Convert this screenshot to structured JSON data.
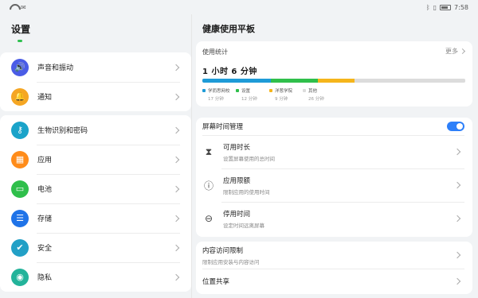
{
  "status": {
    "time": "7:58",
    "left_glyph": "✉"
  },
  "left": {
    "title": "设置",
    "items": [
      {
        "label": "声音和振动",
        "icon": "speaker-icon",
        "color": "#4a5ce6",
        "glyph": "🔊"
      },
      {
        "label": "通知",
        "icon": "bell-icon",
        "color": "#f5a623",
        "glyph": "🔔"
      },
      {
        "label": "生物识别和密码",
        "icon": "key-icon",
        "color": "#1aa3c9",
        "glyph": "⚷"
      },
      {
        "label": "应用",
        "icon": "apps-icon",
        "color": "#ff8c1a",
        "glyph": "▦"
      },
      {
        "label": "电池",
        "icon": "battery-icon",
        "color": "#2fbf4b",
        "glyph": "▭"
      },
      {
        "label": "存储",
        "icon": "storage-icon",
        "color": "#1f73e8",
        "glyph": "☰"
      },
      {
        "label": "安全",
        "icon": "shield-icon",
        "color": "#22a0c6",
        "glyph": "✔"
      },
      {
        "label": "隐私",
        "icon": "privacy-icon",
        "color": "#23b39a",
        "glyph": "◉"
      }
    ]
  },
  "right": {
    "title": "健康使用平板",
    "stats": {
      "label": "使用统计",
      "more": "更多",
      "total": "1 小时 6 分钟",
      "segments": [
        {
          "name": "学而思网校",
          "time": "17 分钟",
          "color": "#1e9bd7",
          "fraction": 0.26
        },
        {
          "name": "设置",
          "time": "12 分钟",
          "color": "#2fbf4b",
          "fraction": 0.18
        },
        {
          "name": "洋葱学院",
          "time": "9 分钟",
          "color": "#f5b51b",
          "fraction": 0.14
        },
        {
          "name": "其他",
          "time": "26 分钟",
          "color": "#dcdcdc",
          "fraction": 0.42
        }
      ]
    },
    "screen_time": {
      "label": "屏幕时间管理",
      "toggle_on": true,
      "rows": [
        {
          "title": "可用时长",
          "sub": "设置屏幕使用的总时间",
          "icon": "hourglass-icon",
          "glyph": "⧗"
        },
        {
          "title": "应用限额",
          "sub": "限制应用的使用时间",
          "icon": "alert-icon",
          "glyph": "ⓘ"
        },
        {
          "title": "停用时间",
          "sub": "设定时间远离屏幕",
          "icon": "block-icon",
          "glyph": "⊖"
        }
      ]
    },
    "content": {
      "title": "内容访问限制",
      "sub": "限制应用安装与内容访问"
    },
    "location": {
      "title": "位置共享"
    }
  }
}
